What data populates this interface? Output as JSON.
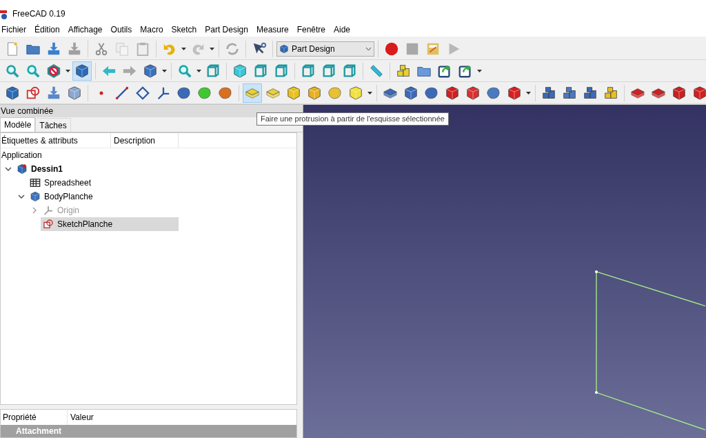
{
  "window": {
    "title": "FreeCAD 0.19"
  },
  "menu": [
    "Fichier",
    "Édition",
    "Affichage",
    "Outils",
    "Macro",
    "Sketch",
    "Part Design",
    "Measure",
    "Fenêtre",
    "Aide"
  ],
  "toolbars": [
    {
      "items": [
        {
          "kind": "doc",
          "color": "#ffffff",
          "pressed": false
        },
        {
          "kind": "folder",
          "color": "#4a7cc0",
          "pressed": false
        },
        {
          "kind": "tray",
          "color": "#3a7fd0",
          "pressed": false
        },
        {
          "kind": "tray",
          "color": "#a0a0a0",
          "pressed": false
        },
        {
          "kind": "sep"
        },
        {
          "kind": "scissors",
          "color": "#909090",
          "pressed": false
        },
        {
          "kind": "pages",
          "color": "#c8c8c8",
          "pressed": false
        },
        {
          "kind": "clipboard",
          "color": "#b0b0b0",
          "pressed": false
        },
        {
          "kind": "sep"
        },
        {
          "kind": "undo",
          "color": "#e8b000",
          "pressed": false
        },
        {
          "kind": "caret"
        },
        {
          "kind": "redo",
          "color": "#c0c0c0",
          "pressed": false
        },
        {
          "kind": "caret"
        },
        {
          "kind": "sep"
        },
        {
          "kind": "refresh",
          "color": "#a8a8a8",
          "pressed": false
        },
        {
          "kind": "sep"
        },
        {
          "kind": "help",
          "color": "#3a4a6a",
          "pressed": false
        },
        {
          "kind": "sep"
        },
        {
          "kind": "combo",
          "value": "Part Design"
        },
        {
          "kind": "sep"
        },
        {
          "kind": "circle",
          "color": "#d81c1c",
          "pressed": false
        },
        {
          "kind": "square",
          "color": "#a8a8a8",
          "pressed": false
        },
        {
          "kind": "notepad",
          "color": "#e0c060",
          "pressed": false
        },
        {
          "kind": "play",
          "color": "#b8b8b8",
          "pressed": false
        }
      ]
    },
    {
      "items": [
        {
          "kind": "magnifier",
          "color": "#2aa0a8",
          "pressed": false
        },
        {
          "kind": "magnifier",
          "color": "#1aa8b0",
          "pressed": false
        },
        {
          "kind": "noentry",
          "color": "#d02040",
          "pressed": false
        },
        {
          "kind": "caret"
        },
        {
          "kind": "cube",
          "color": "#2a6ab8",
          "pressed": true
        },
        {
          "kind": "sep"
        },
        {
          "kind": "left",
          "color": "#30b8c8",
          "pressed": false
        },
        {
          "kind": "right",
          "color": "#a8a8a8",
          "pressed": false
        },
        {
          "kind": "cube",
          "color": "#3a72c0",
          "pressed": false
        },
        {
          "kind": "caret"
        },
        {
          "kind": "sep"
        },
        {
          "kind": "magnifier",
          "color": "#1aa8b0",
          "pressed": false
        },
        {
          "kind": "caret"
        },
        {
          "kind": "wire",
          "color": "#1a9aa0",
          "pressed": false
        },
        {
          "kind": "sep"
        },
        {
          "kind": "cube",
          "color": "#38c8d8",
          "pressed": false
        },
        {
          "kind": "wire",
          "color": "#1a9aa0",
          "pressed": false
        },
        {
          "kind": "wire",
          "color": "#1a9aa0",
          "pressed": false
        },
        {
          "kind": "sep"
        },
        {
          "kind": "wire",
          "color": "#1a9aa0",
          "pressed": false
        },
        {
          "kind": "wire",
          "color": "#1a9aa0",
          "pressed": false
        },
        {
          "kind": "wire",
          "color": "#1a9aa0",
          "pressed": false
        },
        {
          "kind": "sep"
        },
        {
          "kind": "ruler",
          "color": "#30b8d0",
          "pressed": false
        },
        {
          "kind": "sep"
        },
        {
          "kind": "blocks",
          "color": "#e8d030",
          "pressed": false
        },
        {
          "kind": "folder",
          "color": "#6a9ad8",
          "pressed": false
        },
        {
          "kind": "export",
          "color": "#2a4a7a",
          "pressed": false
        },
        {
          "kind": "export",
          "color": "#2a4a7a",
          "pressed": false
        },
        {
          "kind": "caret"
        }
      ]
    },
    {
      "items": [
        {
          "kind": "cube",
          "color": "#2a6ab8",
          "pressed": false
        },
        {
          "kind": "sketch",
          "color": "#d03030",
          "pressed": false
        },
        {
          "kind": "tray",
          "color": "#5a88c8",
          "pressed": false
        },
        {
          "kind": "cube",
          "color": "#8aa8d0",
          "pressed": false
        },
        {
          "kind": "sep"
        },
        {
          "kind": "dot",
          "color": "#d02020",
          "pressed": false
        },
        {
          "kind": "line",
          "color": "#2a5aa8",
          "pressed": false
        },
        {
          "kind": "diamond",
          "color": "#2a5aa8",
          "pressed": false
        },
        {
          "kind": "axes",
          "color": "#2a5aa8",
          "pressed": false
        },
        {
          "kind": "blob",
          "color": "#3a6ab8",
          "pressed": false
        },
        {
          "kind": "blob",
          "color": "#40c830",
          "pressed": false
        },
        {
          "kind": "blob",
          "color": "#d87020",
          "pressed": false
        },
        {
          "kind": "sep"
        },
        {
          "kind": "slab",
          "color": "#e8d030",
          "pressed": true
        },
        {
          "kind": "slab",
          "color": "#e8d040",
          "pressed": false
        },
        {
          "kind": "cube",
          "color": "#e8c020",
          "pressed": false
        },
        {
          "kind": "cube",
          "color": "#e8b020",
          "pressed": false
        },
        {
          "kind": "blob",
          "color": "#e8c030",
          "pressed": false
        },
        {
          "kind": "cube",
          "color": "#f0e040",
          "pressed": false
        },
        {
          "kind": "caret"
        },
        {
          "kind": "sep"
        },
        {
          "kind": "slab",
          "color": "#3a6ab8",
          "pressed": false
        },
        {
          "kind": "cube",
          "color": "#3a6ab8",
          "pressed": false
        },
        {
          "kind": "blob",
          "color": "#3a6ab8",
          "pressed": false
        },
        {
          "kind": "cube",
          "color": "#d02020",
          "pressed": false
        },
        {
          "kind": "cube",
          "color": "#d83030",
          "pressed": false
        },
        {
          "kind": "blob",
          "color": "#4a7ac0",
          "pressed": false
        },
        {
          "kind": "cube",
          "color": "#d82020",
          "pressed": false
        },
        {
          "kind": "caret"
        },
        {
          "kind": "sep"
        },
        {
          "kind": "blocks",
          "color": "#3a6ab8",
          "pressed": false
        },
        {
          "kind": "blocks",
          "color": "#4a7ac0",
          "pressed": false
        },
        {
          "kind": "blocks",
          "color": "#3a6ab8",
          "pressed": false
        },
        {
          "kind": "blocks",
          "color": "#e8c020",
          "pressed": false
        },
        {
          "kind": "sep"
        },
        {
          "kind": "slab",
          "color": "#d82020",
          "pressed": false
        },
        {
          "kind": "slab",
          "color": "#d02020",
          "pressed": false
        },
        {
          "kind": "cube",
          "color": "#c82020",
          "pressed": false
        },
        {
          "kind": "cube",
          "color": "#d02020",
          "pressed": false
        }
      ]
    }
  ],
  "panel": {
    "title": "Vue combinée",
    "tabs": [
      {
        "label": "Modèle",
        "selected": true
      },
      {
        "label": "Tâches",
        "selected": false
      }
    ],
    "tree": {
      "columns": [
        "Étiquettes & attributs",
        "Description"
      ],
      "root": "Application",
      "items": [
        {
          "label": "Dessin1",
          "kind": "document",
          "bold": true,
          "expanded": true,
          "selected": false,
          "disabled": false,
          "children": [
            {
              "label": "Spreadsheet",
              "kind": "spreadsheet",
              "bold": false,
              "selected": false,
              "disabled": false
            },
            {
              "label": "BodyPlanche",
              "kind": "body",
              "bold": false,
              "expanded": true,
              "selected": false,
              "disabled": false,
              "children": [
                {
                  "label": "Origin",
                  "kind": "origin",
                  "bold": false,
                  "expanded": false,
                  "selected": false,
                  "disabled": true
                },
                {
                  "label": "SketchPlanche",
                  "kind": "sketch",
                  "bold": false,
                  "selected": true,
                  "disabled": false
                }
              ]
            }
          ]
        }
      ]
    },
    "properties": {
      "columns": [
        "Propriété",
        "Valeur"
      ],
      "group": "Attachment"
    }
  },
  "tooltip": "Faire une protrusion à partir de l'esquisse sélectionnée"
}
